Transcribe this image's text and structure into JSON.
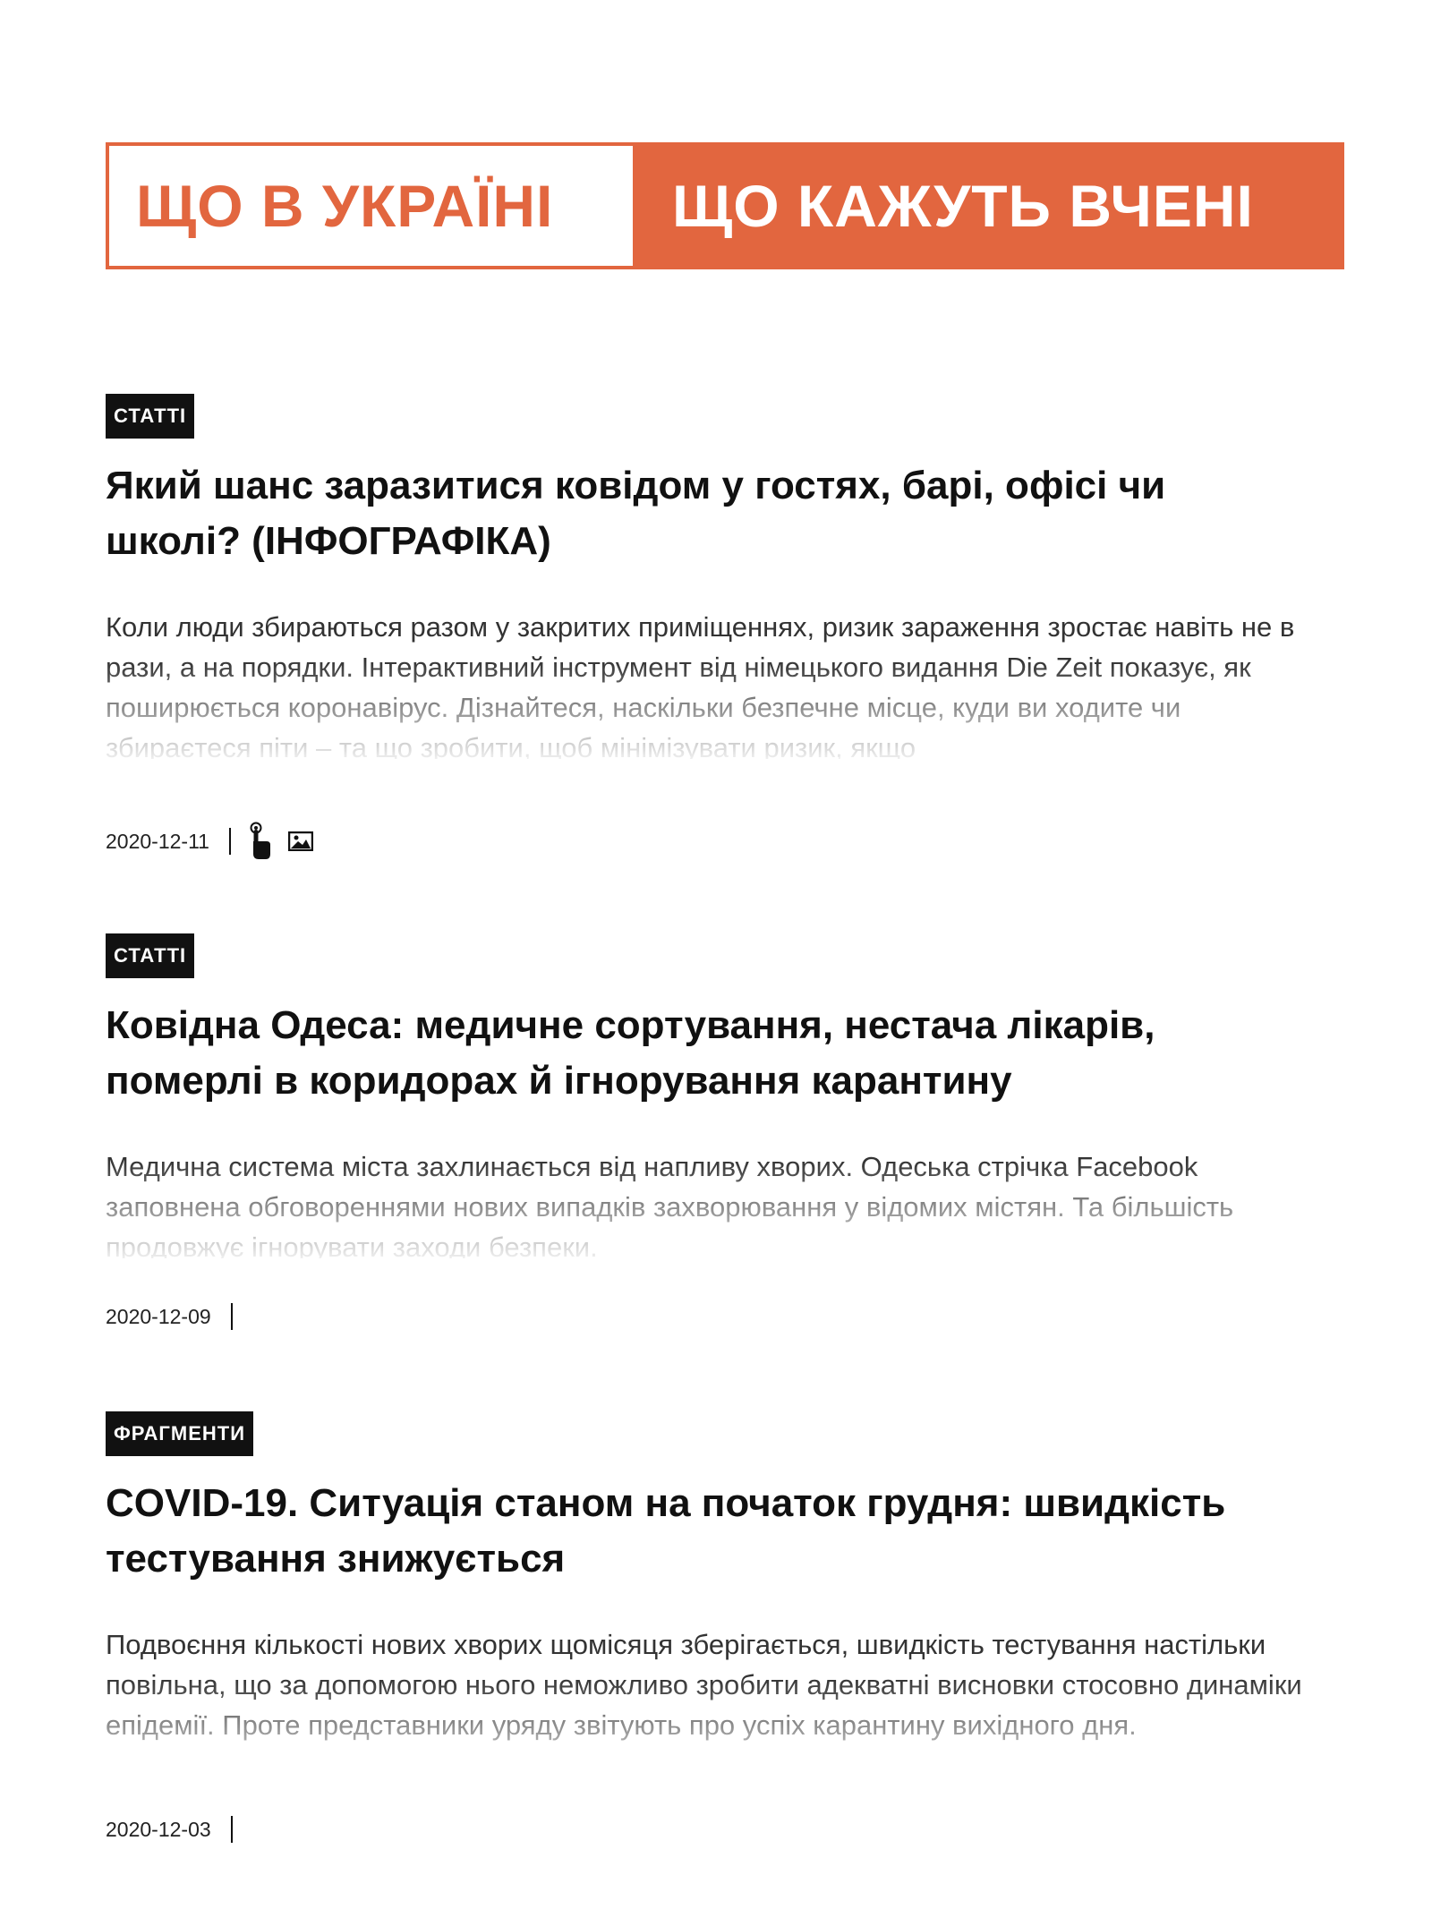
{
  "tabs": [
    {
      "label": "ЩО В УКРАЇНІ",
      "active": false
    },
    {
      "label": "ЩО КАЖУТЬ ВЧЕНІ",
      "active": true
    }
  ],
  "colors": {
    "accent": "#e2663f",
    "badge_bg": "#111111",
    "text": "#111111"
  },
  "articles": [
    {
      "category": "СТАТТІ",
      "title": "Який шанс заразитися ковідом у гостях, барі, офісі чи школі? (ІНФОГРАФІКА)",
      "excerpt": "Коли люди збираються разом у закритих приміщеннях, ризик зараження зростає навіть не в рази, а на порядки. Інтерактивний інструмент від німецького видання Die Zeit показує, як поширюється коронавірус. Дізнайтеся, наскільки безпечне місце, куди ви ходите чи збираєтеся піти – та що зробити, щоб мінімізувати ризик, якщо",
      "date": "2020-12-11",
      "icons": [
        "interactive-touch-icon",
        "image-icon"
      ]
    },
    {
      "category": "СТАТТІ",
      "title": "Ковідна Одеса: медичне сортування, нестача лікарів, померлі в коридорах й ігнорування карантину",
      "excerpt": "Медична система міста захлинається від напливу хворих. Одеська стрічка Facebook заповнена обговореннями нових випадків захворювання у відомих містян. Та більшість продовжує ігнорувати заходи безпеки.",
      "date": "2020-12-09",
      "icons": []
    },
    {
      "category": "ФРАГМЕНТИ",
      "title": "COVID-19. Ситуація станом на початок грудня: швидкість тестування знижується",
      "excerpt": "Подвоєння кількості нових хворих щомісяця зберігається, швидкість тестування настільки повільна, що за допомогою нього неможливо зробити адекватні висновки стосовно динаміки епідемії. Проте представники уряду звітують про успіх карантину вихідного дня.",
      "date": "2020-12-03",
      "icons": []
    }
  ]
}
